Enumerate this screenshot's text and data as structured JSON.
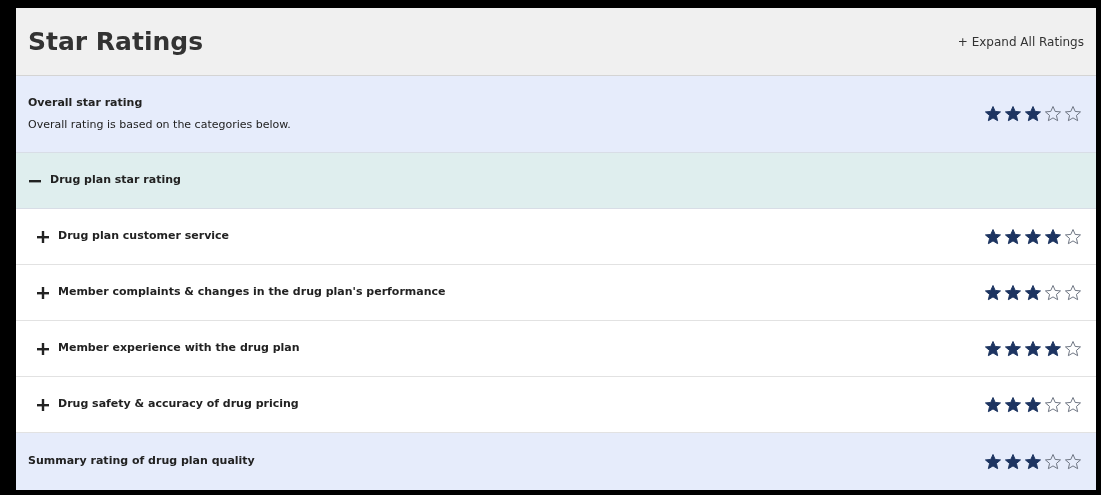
{
  "header": {
    "title": "Star Ratings",
    "expand_all": {
      "label": "+ Expand All Ratings"
    }
  },
  "overall": {
    "title": "Overall star rating",
    "description": "Overall rating is based on the categories below.",
    "stars": 3
  },
  "group": {
    "label": "Drug plan star rating",
    "expanded": true,
    "items": [
      {
        "label": "Drug plan customer service",
        "expanded": false,
        "stars": 4
      },
      {
        "label": "Member complaints & changes in the drug plan's performance",
        "expanded": false,
        "stars": 3
      },
      {
        "label": "Member experience with the drug plan",
        "expanded": false,
        "stars": 4
      },
      {
        "label": "Drug safety & accuracy of drug pricing",
        "expanded": false,
        "stars": 3
      }
    ]
  },
  "summary": {
    "label": "Summary rating of drug plan quality",
    "stars": 3
  }
}
